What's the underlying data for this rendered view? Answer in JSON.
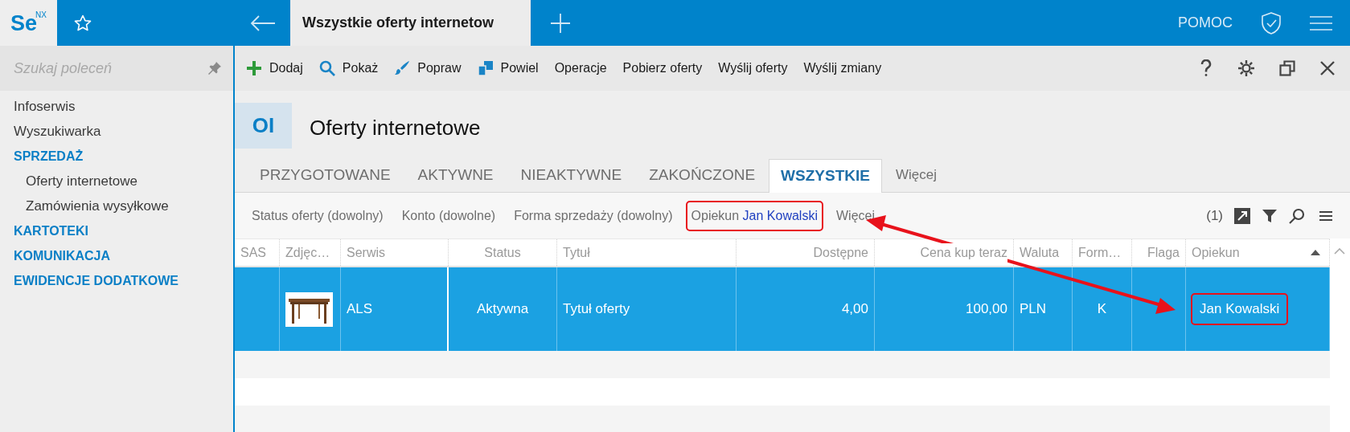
{
  "app": {
    "logo": "Se",
    "logo_sup": "NX"
  },
  "open_tab": {
    "title": "Wszystkie oferty internetow"
  },
  "header_links": [
    "POMOC"
  ],
  "sidebar": {
    "search": {
      "placeholder": "Szukaj poleceń"
    },
    "items": [
      {
        "label": "Infoserwis",
        "kind": "link"
      },
      {
        "label": "Wyszukiwarka",
        "kind": "link"
      },
      {
        "label": "SPRZEDAŻ",
        "kind": "section",
        "children": [
          {
            "label": "Oferty internetowe"
          },
          {
            "label": "Zamówienia wysyłkowe"
          }
        ]
      },
      {
        "label": "KARTOTEKI",
        "kind": "section"
      },
      {
        "label": "KOMUNIKACJA",
        "kind": "section"
      },
      {
        "label": "EWIDENCJE DODATKOWE",
        "kind": "section"
      }
    ]
  },
  "toolbar": {
    "actions": [
      {
        "label": "Dodaj",
        "kind": "plus"
      },
      {
        "label": "Pokaż",
        "kind": "search"
      },
      {
        "label": "Popraw",
        "kind": "brush"
      },
      {
        "label": "Powiel",
        "kind": "copy"
      },
      {
        "label": "Operacje",
        "kind": "text"
      },
      {
        "label": "Pobierz oferty",
        "kind": "text"
      },
      {
        "label": "Wyślij oferty",
        "kind": "text"
      },
      {
        "label": "Wyślij zmiany",
        "kind": "text"
      }
    ]
  },
  "page": {
    "badge": "OI",
    "title": "Oferty internetowe"
  },
  "tabs": [
    {
      "label": "PRZYGOTOWANE",
      "selected": false
    },
    {
      "label": "AKTYWNE",
      "selected": false
    },
    {
      "label": "NIEAKTYWNE",
      "selected": false
    },
    {
      "label": "ZAKOŃCZONE",
      "selected": false
    },
    {
      "label": "WSZYSTKIE",
      "selected": true
    },
    {
      "label": "Więcej",
      "selected": false
    }
  ],
  "filters": [
    {
      "label": "Status oferty (dowolny)",
      "highlighted": false
    },
    {
      "label": "Konto (dowolne)",
      "highlighted": false
    },
    {
      "label": "Forma sprzedaży (dowolny)",
      "highlighted": false
    },
    {
      "label": "Opiekun",
      "value": "Jan Kowalski",
      "highlighted": true
    },
    {
      "label": "Więcej",
      "highlighted": false
    }
  ],
  "filter_count": "(1)",
  "table": {
    "columns": [
      {
        "label": "SAS",
        "sorted": false
      },
      {
        "label": "Zdjęc…",
        "sorted": false
      },
      {
        "label": "Serwis",
        "sorted": false
      },
      {
        "label": "Status",
        "sorted": false
      },
      {
        "label": "Tytuł",
        "sorted": false
      },
      {
        "label": "Dostępne",
        "sorted": false
      },
      {
        "label": "Cena kup teraz",
        "sorted": false
      },
      {
        "label": "Waluta",
        "sorted": false
      },
      {
        "label": "Form…",
        "sorted": false
      },
      {
        "label": "Flaga",
        "sorted": false
      },
      {
        "label": "Opiekun",
        "sorted": true
      }
    ],
    "rows": [
      {
        "selected": true,
        "cells": [
          {
            "kind": "empty"
          },
          {
            "kind": "picture"
          },
          {
            "kind": "text",
            "text": "ALS"
          },
          {
            "kind": "text",
            "text": "Aktywna"
          },
          {
            "kind": "text",
            "text": "Tytuł oferty"
          },
          {
            "kind": "text",
            "text": "4,00"
          },
          {
            "kind": "text",
            "text": "100,00"
          },
          {
            "kind": "text",
            "text": "PLN"
          },
          {
            "kind": "text",
            "text": "K"
          },
          {
            "kind": "empty"
          },
          {
            "kind": "text",
            "text": "Jan Kowalski",
            "highlighted": true
          }
        ]
      }
    ]
  },
  "annotations": [
    {
      "kind": "double-arrow"
    }
  ]
}
